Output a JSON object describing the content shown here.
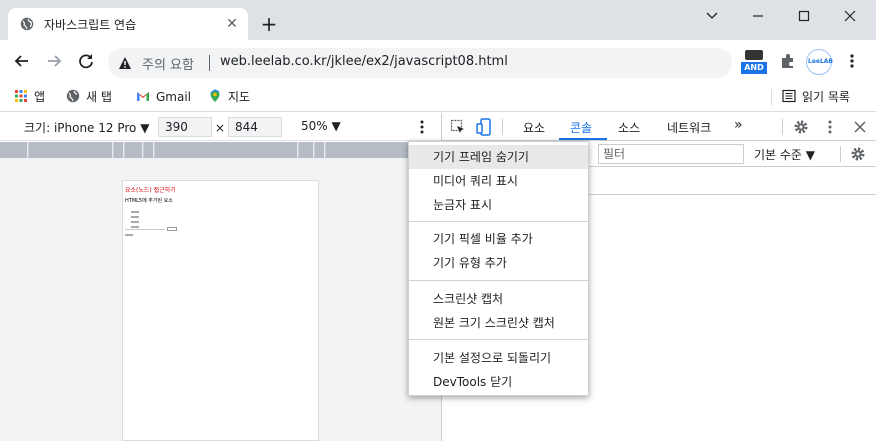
{
  "browser": {
    "tab_title": "자바스크립트 연습",
    "tab_close": "✕",
    "new_tab": "+",
    "security_label": "주의 요함",
    "url": "web.leelab.co.kr/jklee/ex2/javascript08.html",
    "ext_and_label": "AND",
    "ext_leelab_label": "LeeLAB"
  },
  "bookmarks": {
    "apps": "앱",
    "new_tab": "새 탭",
    "gmail": "Gmail",
    "maps": "지도",
    "reading_list": "읽기 목록"
  },
  "device_toolbar": {
    "device": "크기: iPhone 12 Pro ▼",
    "width": "390",
    "times": "×",
    "height": "844",
    "zoom": "50% ▼"
  },
  "page_preview": {
    "heading": "요소(노드) 접근하기",
    "subheading": "HTML5에 추가된 요소"
  },
  "devtools": {
    "tabs": [
      "요소",
      "콘솔",
      "소스",
      "네트워크"
    ],
    "more": "»",
    "filter_placeholder": "필터",
    "level": "기본 수준 ▼"
  },
  "menu": {
    "items": [
      "기기 프레임 숨기기",
      "미디어 쿼리 표시",
      "눈금자 표시",
      "기기 픽셀 비율 추가",
      "기기 유형 추가",
      "스크린샷 캡처",
      "원본 크기 스크린샷 캡처",
      "기본 설정으로 되돌리기",
      "DevTools 닫기"
    ]
  },
  "colors": {
    "accent": "#1a73e8",
    "tabstrip": "#dee1e6",
    "warning_text": "#d00000"
  }
}
